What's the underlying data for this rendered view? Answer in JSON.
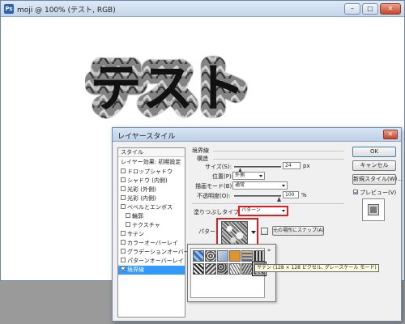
{
  "document": {
    "title": "moji @ 100% (テスト, RGB)",
    "canvas_text": "テスト",
    "buttons": {
      "minimize": "–",
      "maximize": "□",
      "close": "✕"
    }
  },
  "dialog": {
    "title": "レイヤースタイル",
    "close": "✕",
    "style_list": {
      "header": "スタイル",
      "subheader": "レイヤー効果: 初期設定",
      "items": [
        {
          "label": "ドロップシャドウ",
          "checked": false
        },
        {
          "label": "シャドウ (内側)",
          "checked": false
        },
        {
          "label": "光彩 (外側)",
          "checked": false
        },
        {
          "label": "光彩 (内側)",
          "checked": false
        },
        {
          "label": "ベベルとエンボス",
          "checked": false
        },
        {
          "label": "輪郭",
          "checked": false
        },
        {
          "label": "テクスチャ",
          "checked": false
        },
        {
          "label": "サテン",
          "checked": false
        },
        {
          "label": "カラーオーバーレイ",
          "checked": false
        },
        {
          "label": "グラデーションオーバーレイ",
          "checked": false
        },
        {
          "label": "パターンオーバーレイ",
          "checked": false
        },
        {
          "label": "境界線",
          "checked": true,
          "selected": true
        }
      ]
    },
    "buttons": {
      "ok": "OK",
      "cancel": "キャンセル",
      "new_style": "新規スタイル(W)...",
      "preview": "プレビュー(V)",
      "preview_checked": true
    },
    "stroke": {
      "group_title": "境界線",
      "structure_title": "構造",
      "size_label": "サイズ(S):",
      "size_value": "24",
      "size_unit": "px",
      "position_label": "位置(P):",
      "position_value": "外側",
      "blend_label": "描画モード(B):",
      "blend_value": "通常",
      "opacity_label": "不透明度(O):",
      "opacity_value": "100",
      "opacity_unit": "%",
      "fill_type_label": "塗りつぶしタイプ(F):",
      "fill_type_value": "パターン",
      "pattern_label": "パターン:",
      "snap_button": "元の場所にスナップ(A)",
      "picker_menu": "»",
      "tooltip": "サテン (128 × 128 ピクセル, グレースケール モード)"
    }
  },
  "colors": {
    "highlight_red": "#dd1f1f",
    "selection_blue": "#3399ff"
  }
}
